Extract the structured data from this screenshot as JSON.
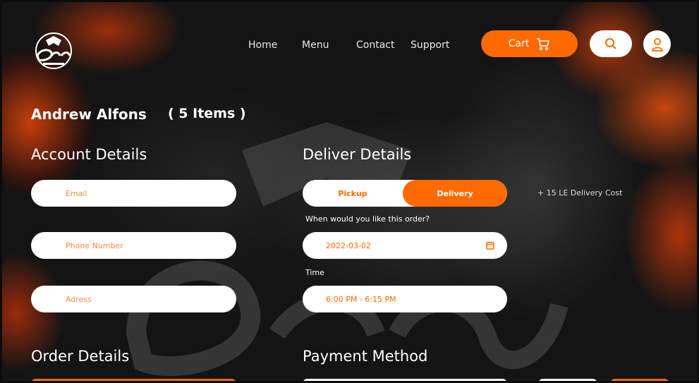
{
  "nav": {
    "links": [
      "Home",
      "Menu",
      "Contact",
      "Support"
    ],
    "cart_label": "Cart"
  },
  "customer": {
    "name": "Andrew Alfons",
    "items": "( 5 Items )"
  },
  "account": {
    "title": "Account Details",
    "email_placeholder": "Email",
    "phone_placeholder": "Phone Number",
    "address_placeholder": "Adress"
  },
  "delivery": {
    "title": "Deliver Details",
    "pickup_label": "Pickup",
    "delivery_label": "Delivery",
    "selected": "Delivery",
    "cost_note": "+ 15 LE Delivery Cost",
    "when_label": "When would you like this order?",
    "date_value": "2022-03-02",
    "time_label": "Time",
    "time_value": "6:00 PM - 6:15 PM"
  },
  "order": {
    "title": "Order Details"
  },
  "payment": {
    "title": "Payment Method"
  },
  "colors": {
    "accent": "#ff6a00",
    "field_bg": "#ffffff",
    "text": "#ffffff"
  },
  "icons": [
    "bread-logo",
    "cart-icon",
    "search-icon",
    "user-icon",
    "calendar-icon"
  ]
}
